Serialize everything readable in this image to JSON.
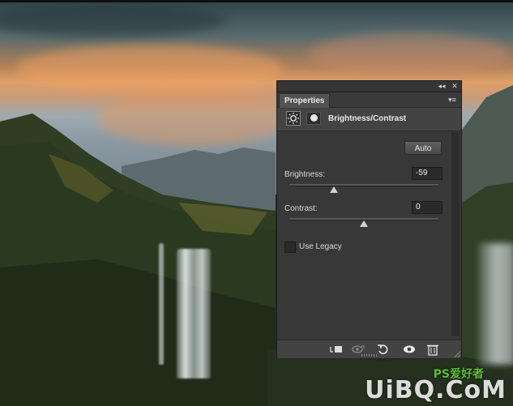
{
  "panel": {
    "tab_label": "Properties",
    "collapse_glyph": "◂◂",
    "close_glyph": "✕",
    "menu_glyph": "▾≡",
    "adjustment_name": "Brightness/Contrast",
    "auto_label": "Auto",
    "brightness_label": "Brightness:",
    "brightness_value": "-59",
    "brightness_slider_fraction": 0.3,
    "contrast_label": "Contrast:",
    "contrast_value": "0",
    "contrast_slider_fraction": 0.5,
    "legacy_label": "Use Legacy",
    "legacy_checked": false
  },
  "icons": {
    "adjustment": "sun-brightness-icon",
    "mask": "layer-mask-icon",
    "clip": "clip-to-layer-icon",
    "view_previous": "view-previous-state-icon",
    "reset": "reset-icon",
    "visibility": "eye-icon",
    "delete": "trash-icon"
  },
  "watermark": {
    "brand": "UiBQ.CoM",
    "brand_small": "PS爱好者"
  }
}
